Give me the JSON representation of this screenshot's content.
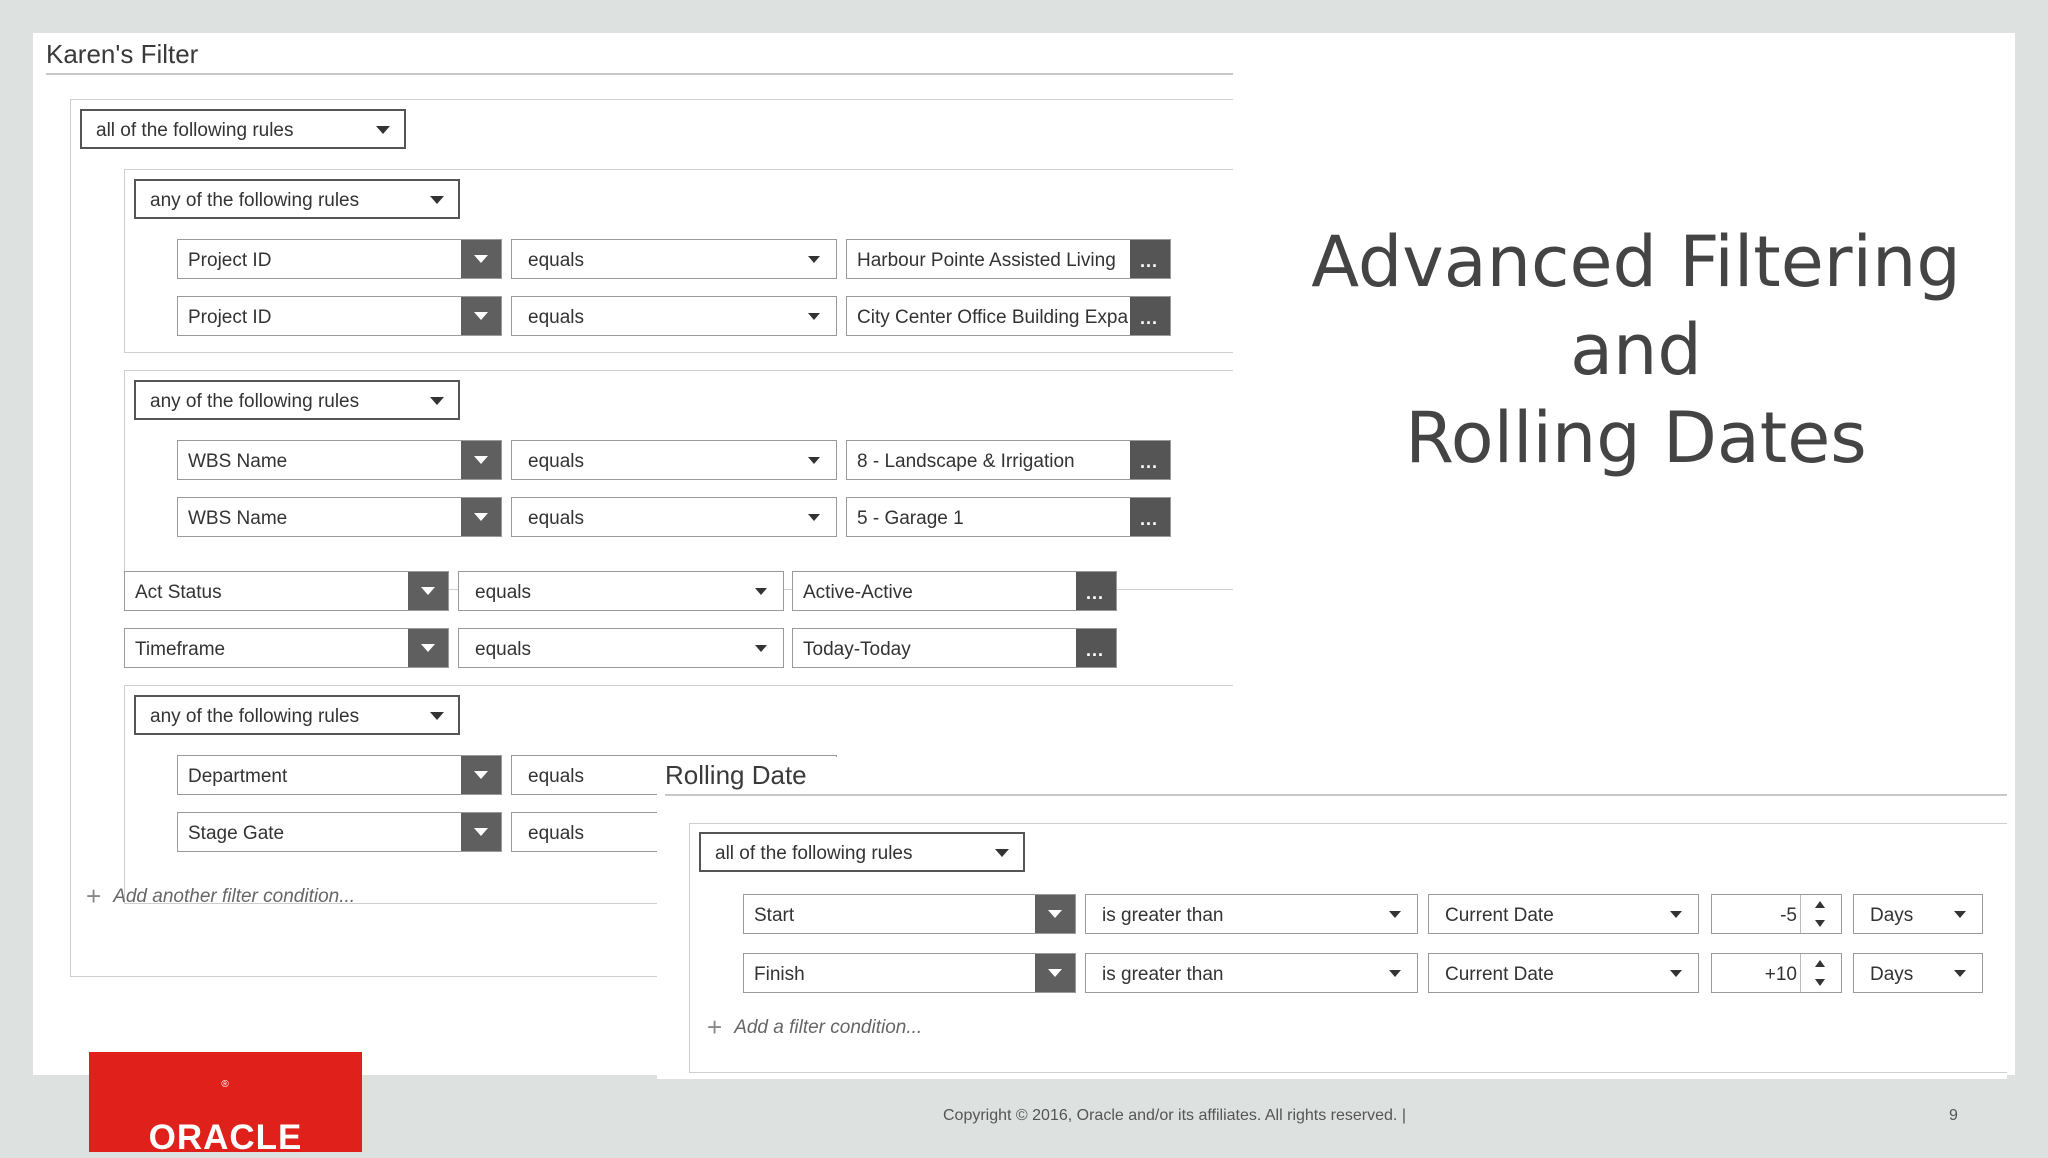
{
  "slide": {
    "heading_line1": "Advanced Filtering",
    "heading_line2": "and",
    "heading_line3": "Rolling Dates",
    "copyright": "Copyright © 2016, Oracle and/or its affiliates. All rights reserved.  |",
    "page_number": "9",
    "logo_text": "ORACLE",
    "logo_mark": "®"
  },
  "filter_panel": {
    "title": "Karen's Filter",
    "root_match": "all of the following rules",
    "group1": {
      "match": "any of the following rules",
      "rows": [
        {
          "field": "Project ID",
          "operator": "equals",
          "value": "Harbour Pointe Assisted Living"
        },
        {
          "field": "Project ID",
          "operator": "equals",
          "value": "City Center Office Building Expa"
        }
      ]
    },
    "group2": {
      "match": "any of the following rules",
      "rows": [
        {
          "field": "WBS Name",
          "operator": "equals",
          "value": "8 - Landscape & Irrigation"
        },
        {
          "field": "WBS Name",
          "operator": "equals",
          "value": "5 - Garage 1"
        }
      ]
    },
    "top_rows": [
      {
        "field": "Act Status",
        "operator": "equals",
        "value": "Active-Active"
      },
      {
        "field": "Timeframe",
        "operator": "equals",
        "value": "Today-Today"
      }
    ],
    "group3": {
      "match": "any of the following rules",
      "rows": [
        {
          "field": "Department",
          "operator": "equals"
        },
        {
          "field": "Stage Gate",
          "operator": "equals"
        }
      ]
    },
    "add_condition": "Add another filter condition..."
  },
  "rolling_panel": {
    "title": "Rolling Date",
    "match": "all of the following rules",
    "rows": [
      {
        "field": "Start",
        "operator": "is greater than",
        "reference": "Current Date",
        "offset": "-5",
        "unit": "Days"
      },
      {
        "field": "Finish",
        "operator": "is greater than",
        "reference": "Current Date",
        "offset": "+10",
        "unit": "Days"
      }
    ],
    "add_condition": "Add a filter condition..."
  }
}
